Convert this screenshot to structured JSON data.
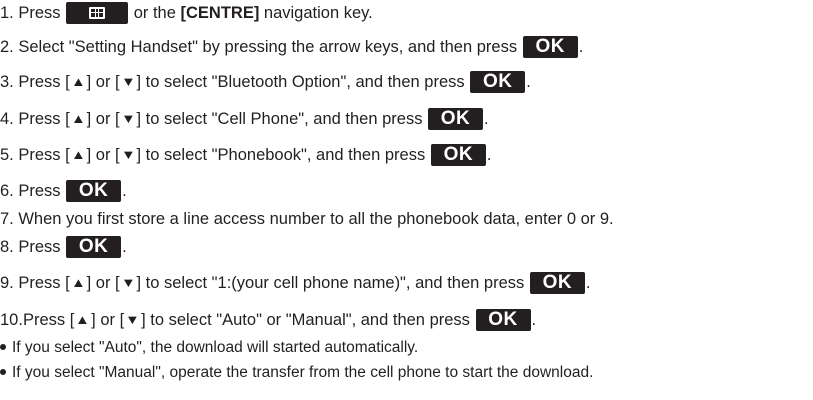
{
  "steps": [
    {
      "num": "1.",
      "a": "Press ",
      "menu_key_icon": "grid-menu-icon",
      "b": " or the ",
      "c": "[CENTRE]",
      "d": " navigation key."
    },
    {
      "num": "2.",
      "a": "Select \"Setting Handset\" by pressing the arrow keys, and then press ",
      "ok": "OK",
      "end": "."
    },
    {
      "num": "3.",
      "a": "Press [",
      "up": "▲",
      "b": "] or [",
      "down": "▼",
      "c": "] to select \"Bluetooth Option\", and then press ",
      "ok": "OK",
      "end": "."
    },
    {
      "num": "4.",
      "a": "Press [",
      "up": "▲",
      "b": "] or [",
      "down": "▼",
      "c": "] to select \"Cell Phone\", and then press ",
      "ok": "OK",
      "end": "."
    },
    {
      "num": "5.",
      "a": "Press [",
      "up": "▲",
      "b": "] or [",
      "down": "▼",
      "c": "] to select \"Phonebook\", and then press ",
      "ok": "OK",
      "end": "."
    },
    {
      "num": "6.",
      "a": "Press ",
      "ok": "OK",
      "end": "."
    },
    {
      "num": "7.",
      "a": "When you first store a line access number to all the phonebook data, enter 0 or 9."
    },
    {
      "num": "8.",
      "a": "Press ",
      "ok": "OK",
      "end": "."
    },
    {
      "num": "9.",
      "a": "Press [",
      "up": "▲",
      "b": "] or [",
      "down": "▼",
      "c": "] to select \"1:(your cell phone name)\", and then press ",
      "ok": "OK",
      "end": "."
    },
    {
      "num": "10.",
      "a": "Press [",
      "up": "▲",
      "b": "] or [",
      "down": "▼",
      "c": "] to select \"Auto\" or \"Manual\", and then press ",
      "ok": "OK",
      "end": "."
    }
  ],
  "bullets": [
    "If you select \"Auto\", the download will started automatically.",
    "If you select \"Manual\", operate the transfer from the cell phone to start the download."
  ],
  "colors": {
    "text": "#231f20",
    "key_background": "#231f20",
    "key_text": "#ffffff"
  }
}
